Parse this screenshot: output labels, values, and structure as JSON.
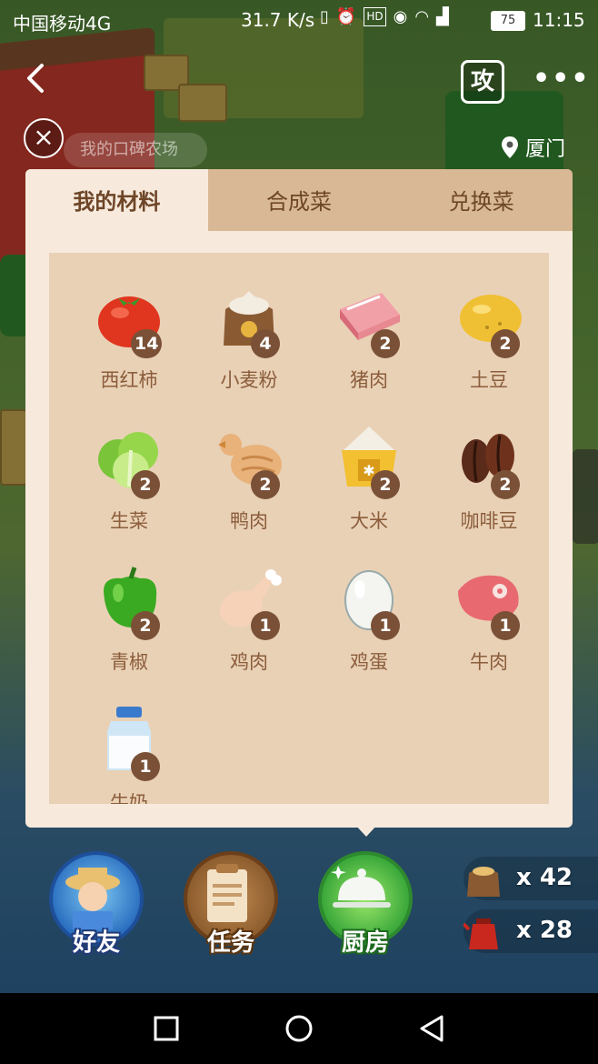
{
  "status_bar": {
    "carrier": "中国移动4G",
    "speed": "31.7 K/s",
    "icons": [
      "vibrate-icon",
      "alarm-icon",
      "hd-icon",
      "eye-icon",
      "wifi-icon",
      "signal-icon"
    ],
    "hd_text": "HD",
    "battery": "75",
    "time": "11:15"
  },
  "header": {
    "back_glyph": "<",
    "strategy_label": "攻",
    "more_glyph": "•••",
    "close_glyph": "×",
    "shop_text": "我的口碑农场",
    "location": "厦门"
  },
  "panel": {
    "tabs": [
      {
        "label": "我的材料",
        "active": true
      },
      {
        "label": "合成菜",
        "active": false
      },
      {
        "label": "兑换菜",
        "active": false
      }
    ],
    "items": [
      {
        "name": "西红柿",
        "count": "14",
        "icon": "tomato-icon"
      },
      {
        "name": "小麦粉",
        "count": "4",
        "icon": "flour-sack-icon"
      },
      {
        "name": "猪肉",
        "count": "2",
        "icon": "pork-icon"
      },
      {
        "name": "土豆",
        "count": "2",
        "icon": "potato-icon"
      },
      {
        "name": "生菜",
        "count": "2",
        "icon": "lettuce-icon"
      },
      {
        "name": "鸭肉",
        "count": "2",
        "icon": "duck-icon"
      },
      {
        "name": "大米",
        "count": "2",
        "icon": "rice-icon"
      },
      {
        "name": "咖啡豆",
        "count": "2",
        "icon": "coffee-bean-icon"
      },
      {
        "name": "青椒",
        "count": "2",
        "icon": "green-pepper-icon"
      },
      {
        "name": "鸡肉",
        "count": "1",
        "icon": "chicken-leg-icon"
      },
      {
        "name": "鸡蛋",
        "count": "1",
        "icon": "egg-icon"
      },
      {
        "name": "牛肉",
        "count": "1",
        "icon": "beef-icon"
      },
      {
        "name": "牛奶",
        "count": "1",
        "icon": "milk-bottle-icon"
      }
    ]
  },
  "bottom_nav": {
    "friends_label": "好友",
    "tasks_label": "任务",
    "kitchen_label": "厨房",
    "resources": [
      {
        "icon": "flour-sack-icon",
        "value": "x 42"
      },
      {
        "icon": "oil-kettle-icon",
        "value": "x 28"
      }
    ]
  },
  "system_nav": [
    "recent-apps-icon",
    "home-icon",
    "back-triangle-icon"
  ],
  "colors": {
    "panel_bg": "#f7eadc",
    "tab_bar": "#d8b895",
    "grid_bg": "#e9d1b6",
    "badge": "#7a5137",
    "item_text": "#8b5d3b"
  }
}
